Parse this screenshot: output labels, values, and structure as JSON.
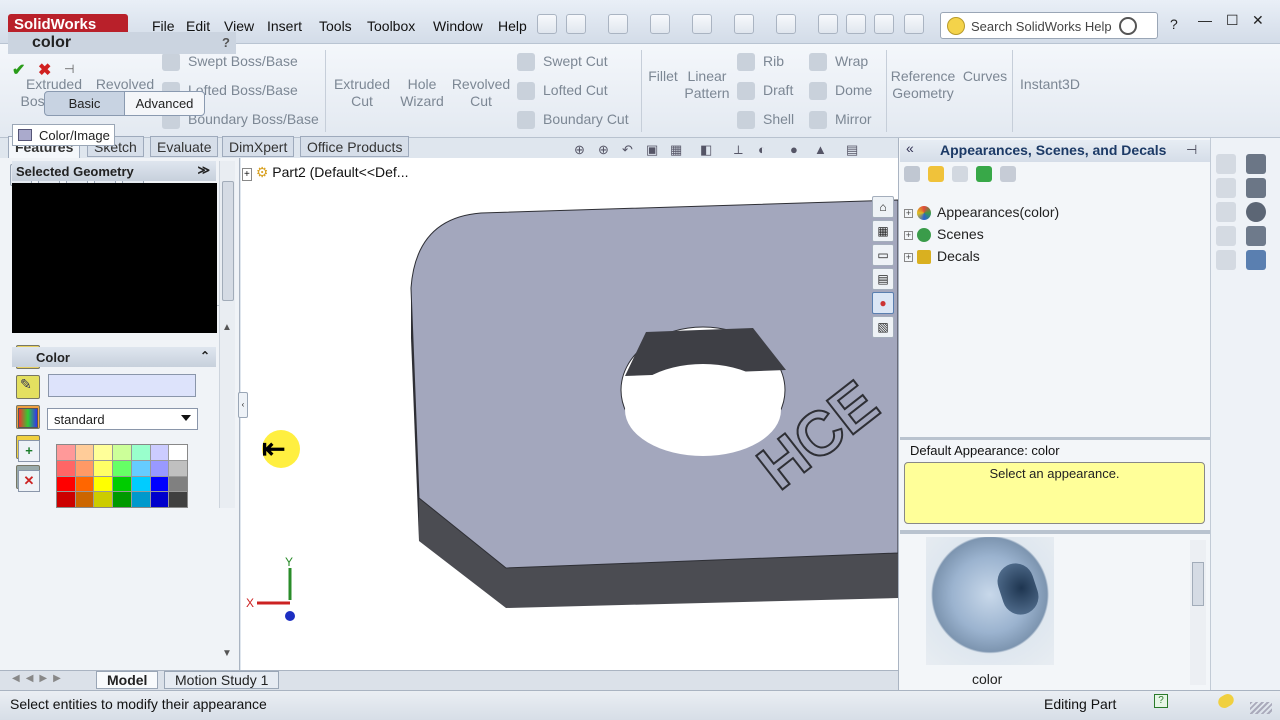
{
  "app": {
    "logo_text": "SolidWorks"
  },
  "menu": [
    "File",
    "Edit",
    "View",
    "Insert",
    "Tools",
    "Toolbox",
    "Window",
    "Help"
  ],
  "search": {
    "placeholder": "Search SolidWorks Help"
  },
  "window_controls": {
    "help": "?",
    "minimize": "—",
    "maximize": "☐",
    "close": "✕"
  },
  "command_manager": {
    "extruded_boss": "Extruded\nBoss/Base",
    "revolved_boss": "Revolved\nBoss/Base",
    "swept_boss": "Swept Boss/Base",
    "lofted_boss": "Lofted Boss/Base",
    "boundary_boss": "Boundary Boss/Base",
    "extruded_cut": "Extruded\nCut",
    "hole_wizard": "Hole\nWizard",
    "revolved_cut": "Revolved\nCut",
    "swept_cut": "Swept Cut",
    "lofted_cut": "Lofted Cut",
    "boundary_cut": "Boundary Cut",
    "fillet": "Fillet",
    "linear_pattern": "Linear\nPattern",
    "rib": "Rib",
    "draft": "Draft",
    "shell": "Shell",
    "wrap": "Wrap",
    "dome": "Dome",
    "mirror": "Mirror",
    "reference_geometry": "Reference\nGeometry",
    "curves": "Curves",
    "instant3d": "Instant3D"
  },
  "tabs": [
    "Features",
    "Sketch",
    "Evaluate",
    "DimXpert",
    "Office Products"
  ],
  "property_manager": {
    "title": "color",
    "help": "?",
    "basic_label": "Basic",
    "advanced_label": "Advanced",
    "colorimage_tab": "Color/Image",
    "selected_geometry_title": "Selected Geometry",
    "color_title": "Color",
    "color_value": "",
    "palette_select": "standard",
    "swatches": [
      "#ff9999",
      "#ffcc99",
      "#ffff99",
      "#ccff99",
      "#99ffcc",
      "#ccccff",
      "#ffffff",
      "#ff6666",
      "#ff9966",
      "#ffff66",
      "#66ff66",
      "#66ccff",
      "#9999ff",
      "#c0c0c0",
      "#ff0000",
      "#ff6600",
      "#ffff00",
      "#00cc00",
      "#00ccff",
      "#0000ff",
      "#808080",
      "#cc0000",
      "#cc6600",
      "#cccc00",
      "#009900",
      "#0099cc",
      "#0000cc",
      "#404040"
    ]
  },
  "feature_tree": {
    "root": "Part2  (Default<<Def..."
  },
  "graphics": {
    "axis_x": "X",
    "axis_y": "Y",
    "part_color": "#a3a7bd",
    "edge_color": "#4b4c52"
  },
  "bottom_tabs": [
    "Model",
    "Motion Study 1"
  ],
  "task_pane": {
    "title": "Appearances, Scenes, and Decals",
    "tree": [
      {
        "label": "Appearances(color)",
        "color": "#e04a3a"
      },
      {
        "label": "Scenes",
        "color": "#3a9c4a"
      },
      {
        "label": "Decals",
        "color": "#d9b020"
      }
    ],
    "default_appearance": "Default Appearance: color",
    "prompt": "Select an appearance.",
    "thumbnail_label": "color"
  },
  "status": {
    "message": "Select entities to modify their appearance",
    "mode": "Editing Part"
  }
}
